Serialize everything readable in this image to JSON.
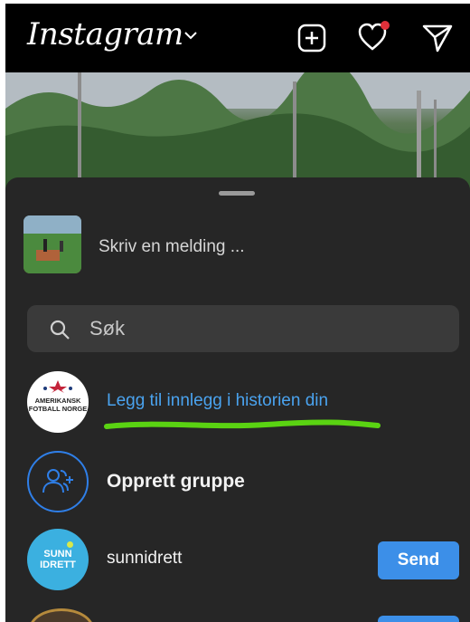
{
  "header": {
    "logo": "Instagram",
    "icons": [
      "plus-square-icon",
      "heart-icon",
      "paper-plane-icon"
    ],
    "has_notification_dot": true
  },
  "share_sheet": {
    "message_placeholder": "Skriv en melding ...",
    "search_placeholder": "Søk",
    "story_row": {
      "label": "Legg til innlegg i historien din",
      "avatar_text_line1": "AMERIKANSK",
      "avatar_text_line2": "FOTBALL NORGE"
    },
    "group_row": {
      "label": "Opprett gruppe"
    },
    "contacts": [
      {
        "username": "sunnidrett",
        "avatar_line1": "SUNN",
        "avatar_line2": "IDRETT",
        "button": "Send"
      }
    ]
  },
  "colors": {
    "sheet_bg": "#262626",
    "accent_blue": "#3c8fe8",
    "link_blue": "#4aa3ef",
    "highlight_green": "#5ad312",
    "notification_red": "#e0303a"
  }
}
